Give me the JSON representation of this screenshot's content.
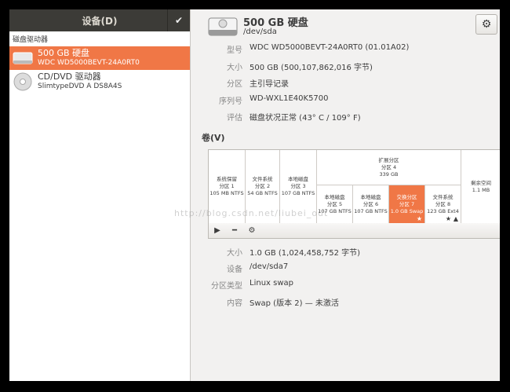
{
  "sidebar": {
    "header": "设备(D)",
    "section_label": "磁盘驱动器",
    "drives": [
      {
        "name": "500 GB 硬盘",
        "sub": "WDC WD5000BEVT-24A0RT0",
        "selected": true
      },
      {
        "name": "CD/DVD 驱动器",
        "sub": "SlimtypeDVD A DS8A4S",
        "selected": false
      }
    ]
  },
  "disk": {
    "title": "500 GB 硬盘",
    "path": "/dev/sda",
    "props": [
      {
        "key": "型号",
        "value": "WDC WD5000BEVT-24A0RT0 (01.01A02)"
      },
      {
        "key": "大小",
        "value": "500 GB (500,107,862,016 字节)"
      },
      {
        "key": "分区",
        "value": "主引导记录"
      },
      {
        "key": "序列号",
        "value": "WD-WXL1E40K5700"
      },
      {
        "key": "评估",
        "value": "磁盘状况正常 (43° C / 109° F)"
      }
    ]
  },
  "volumes": {
    "label": "卷(V)",
    "partitions": [
      {
        "line1": "系统保留",
        "line2": "分区 1",
        "line3": "105 MB NTFS"
      },
      {
        "line1": "文件系统",
        "line2": "分区 2",
        "line3": "54 GB NTFS"
      },
      {
        "line1": "本地磁盘",
        "line2": "分区 3",
        "line3": "107 GB NTFS"
      }
    ],
    "extended": {
      "line1": "扩展分区",
      "line2": "分区 4",
      "line3": "339 GB"
    },
    "logical": [
      {
        "line1": "本地磁盘",
        "line2": "分区 5",
        "line3": "107 GB NTFS"
      },
      {
        "line1": "本地磁盘",
        "line2": "分区 6",
        "line3": "107 GB NTFS"
      },
      {
        "line1": "交换分区",
        "line2": "分区 7",
        "line3": "1.0 GB Swap"
      },
      {
        "line1": "文件系统",
        "line2": "分区 8",
        "line3": "123 GB Ext4"
      }
    ],
    "free": {
      "line1": "剩余空间",
      "line2": "1.1 MB"
    }
  },
  "selected_partition": {
    "props": [
      {
        "key": "大小",
        "value": "1.0 GB (1,024,458,752 字节)"
      },
      {
        "key": "设备",
        "value": "/dev/sda7"
      },
      {
        "key": "分区类型",
        "value": "Linux swap"
      },
      {
        "key": "内容",
        "value": "Swap (版本 2) — 未激活"
      }
    ]
  },
  "watermark": "http://blog.csdn.net/liubei_out",
  "colors": {
    "accent": "#f07746",
    "header_bg": "#3c3b37"
  }
}
